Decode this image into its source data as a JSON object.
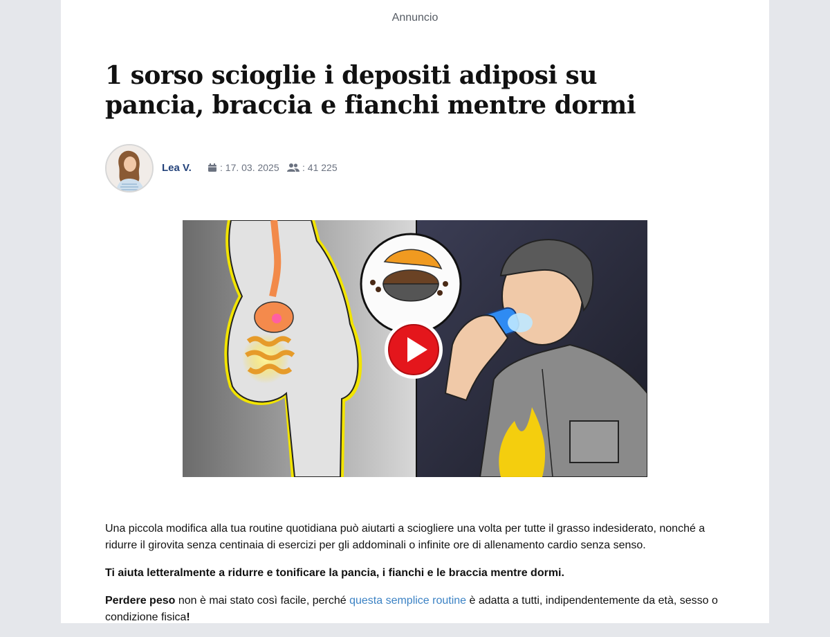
{
  "ad_label": "Annuncio",
  "article": {
    "title": "1 sorso scioglie i depositi adiposi su pancia, braccia e fianchi mentre dormi",
    "author": "Lea V.",
    "date": ": 17. 03. 2025",
    "readers": ": 41 225"
  },
  "icons": {
    "date": "calendar-icon",
    "readers": "users-icon",
    "video": "play-icon"
  },
  "colors": {
    "author": "#23427a",
    "link": "#3b82c4",
    "play_button": "#e4161c"
  },
  "body": {
    "p1": "Una piccola modifica alla tua routine quotidiana può aiutarti a sciogliere una volta per tutte il grasso indesiderato, nonché a ridurre il girovita senza centinaia di esercizi per gli addominali o infinite ore di allenamento cardio senza senso.",
    "p2": "Ti aiuta letteralmente a ridurre e tonificare la pancia, i fianchi e le braccia mentre dormi.",
    "p3_bold": "Perdere peso",
    "p3_a": " non è mai stato così facile, perché ",
    "p3_link": "questa semplice routine",
    "p3_b": " è adatta a tutti, indipendentemente da età, sesso o condizione fisica",
    "p3_end": "!"
  }
}
